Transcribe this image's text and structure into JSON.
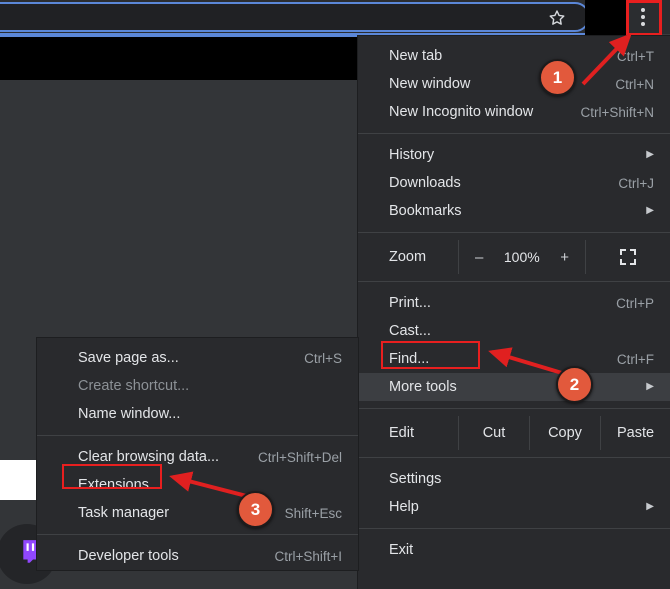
{
  "browser": {
    "omnibox_placeholder": "",
    "star_icon": "bookmark-star-icon",
    "kebab_icon": "three-dot-menu-icon",
    "taskbar_icon": "twitch-icon"
  },
  "main_menu": {
    "items": [
      {
        "label": "New tab",
        "accel": "Ctrl+T",
        "caret": false,
        "dim": false
      },
      {
        "label": "New window",
        "accel": "Ctrl+N",
        "caret": false,
        "dim": false
      },
      {
        "label": "New Incognito window",
        "accel": "Ctrl+Shift+N",
        "caret": false,
        "dim": false
      }
    ],
    "group2": [
      {
        "label": "History",
        "accel": "",
        "caret": true,
        "dim": false
      },
      {
        "label": "Downloads",
        "accel": "Ctrl+J",
        "caret": false,
        "dim": false
      },
      {
        "label": "Bookmarks",
        "accel": "",
        "caret": true,
        "dim": false
      }
    ],
    "zoom": {
      "label": "Zoom",
      "minus": "–",
      "value": "100%",
      "plus": "+",
      "fullscreen_icon": "fullscreen-icon"
    },
    "group3": [
      {
        "label": "Print...",
        "accel": "Ctrl+P",
        "caret": false,
        "dim": false
      },
      {
        "label": "Cast...",
        "accel": "",
        "caret": false,
        "dim": false
      },
      {
        "label": "Find...",
        "accel": "Ctrl+F",
        "caret": false,
        "dim": false
      },
      {
        "label": "More tools",
        "accel": "",
        "caret": true,
        "dim": false
      }
    ],
    "edit_row": {
      "label": "Edit",
      "cut": "Cut",
      "copy": "Copy",
      "paste": "Paste"
    },
    "group4": [
      {
        "label": "Settings",
        "accel": "",
        "caret": false,
        "dim": false
      },
      {
        "label": "Help",
        "accel": "",
        "caret": true,
        "dim": false
      }
    ],
    "group5": [
      {
        "label": "Exit",
        "accel": "",
        "caret": false,
        "dim": false
      }
    ]
  },
  "more_tools_submenu": {
    "group1": [
      {
        "label": "Save page as...",
        "accel": "Ctrl+S",
        "dim": false
      },
      {
        "label": "Create shortcut...",
        "accel": "",
        "dim": true
      },
      {
        "label": "Name window...",
        "accel": "",
        "dim": false
      }
    ],
    "group2": [
      {
        "label": "Clear browsing data...",
        "accel": "Ctrl+Shift+Del",
        "dim": false
      },
      {
        "label": "Extensions",
        "accel": "",
        "dim": false
      },
      {
        "label": "Task manager",
        "accel": "Shift+Esc",
        "dim": false
      }
    ],
    "group3": [
      {
        "label": "Developer tools",
        "accel": "Ctrl+Shift+I",
        "dim": false
      }
    ]
  },
  "annotations": {
    "badges": [
      {
        "number": "1"
      },
      {
        "number": "2"
      },
      {
        "number": "3"
      }
    ],
    "highlight_color": "#e81f1f",
    "badge_color": "#e2593c",
    "arrow_color": "#e02020"
  }
}
